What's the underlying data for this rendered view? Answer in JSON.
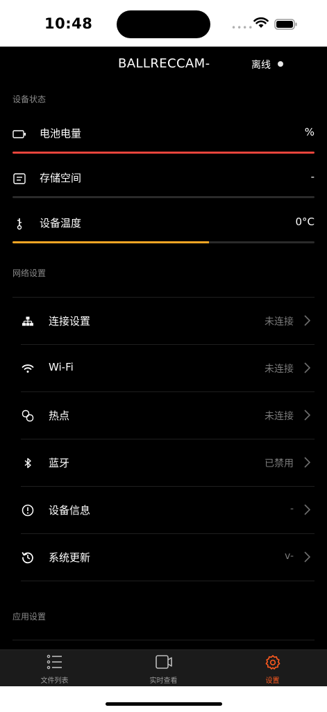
{
  "status_bar": {
    "time": "10:48"
  },
  "header": {
    "title": "BALLRECCAM-",
    "connection_status": "离线"
  },
  "device_status": {
    "section_label": "设备状态",
    "items": [
      {
        "label": "电池电量",
        "value": "%",
        "icon": "battery-icon",
        "bar_color": "#e8453c",
        "level": 1.0
      },
      {
        "label": "存储空间",
        "value": "-",
        "icon": "storage-icon",
        "bar_color": "#2a2a2a",
        "level": 0.0
      },
      {
        "label": "设备温度",
        "value": "0°C",
        "icon": "thermometer-icon",
        "bar_color": "#f5a524",
        "level": 0.65
      }
    ]
  },
  "network": {
    "section_label": "网络设置",
    "items": [
      {
        "label": "连接设置",
        "value": "未连接",
        "icon": "network-icon"
      },
      {
        "label": "Wi-Fi",
        "value": "未连接",
        "icon": "wifi-icon"
      },
      {
        "label": "热点",
        "value": "未连接",
        "icon": "hotspot-icon"
      },
      {
        "label": "蓝牙",
        "value": "已禁用",
        "icon": "bluetooth-icon"
      },
      {
        "label": "设备信息",
        "value": "-",
        "icon": "info-icon"
      },
      {
        "label": "系统更新",
        "value": "v-",
        "icon": "update-icon"
      }
    ]
  },
  "app_settings": {
    "section_label": "应用设置"
  },
  "tab_bar": {
    "active_color": "#ff5a1f",
    "tabs": [
      {
        "label": "文件列表",
        "icon": "list-icon"
      },
      {
        "label": "实时查看",
        "icon": "camera-icon"
      },
      {
        "label": "设置",
        "icon": "gear-icon",
        "active": true
      }
    ]
  }
}
